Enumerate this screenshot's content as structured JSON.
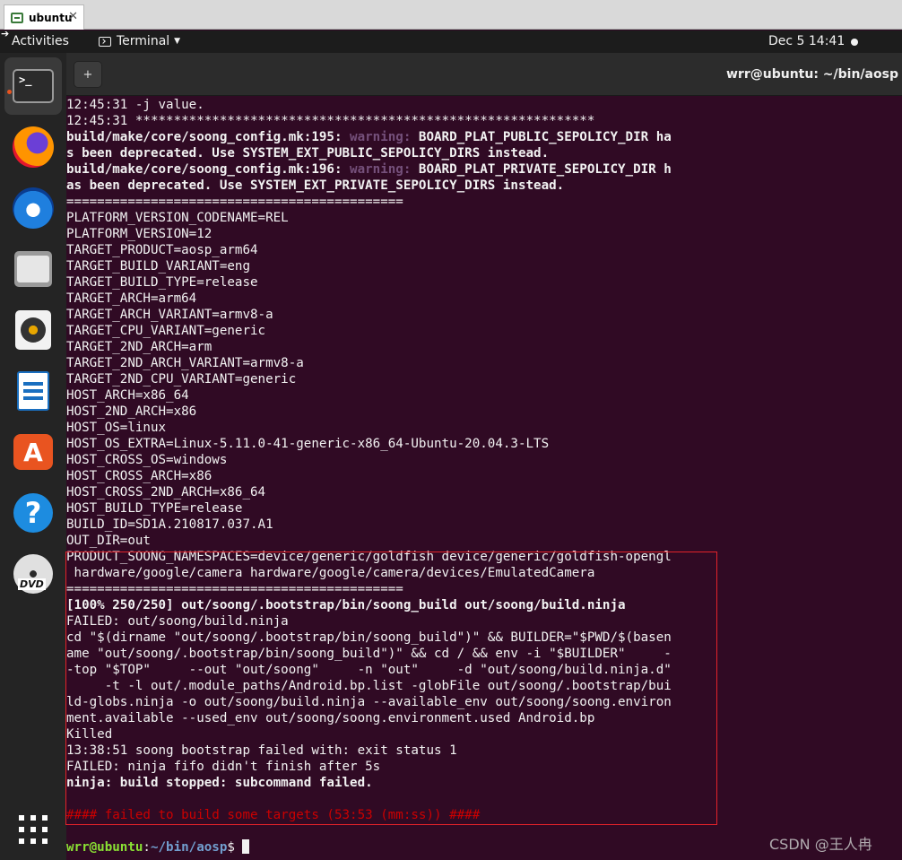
{
  "vm_tab": {
    "label": "ubuntu",
    "close": "✕"
  },
  "topbar": {
    "activities": "Activities",
    "app_menu": "Terminal",
    "clock": "Dec 5  14:41"
  },
  "dock": {
    "items": [
      "Terminal",
      "Firefox",
      "Thunderbird",
      "Files",
      "Rhythmbox",
      "LibreOffice Writer",
      "Ubuntu Software",
      "Help",
      "DVD",
      "Show Applications"
    ],
    "terminal_glyph": ">_",
    "dvd_label": "DVD",
    "help_glyph": "?",
    "store_glyph": "A"
  },
  "terminal": {
    "title": "wrr@ubuntu: ~/bin/aosp",
    "newtab_glyph": "+",
    "lines": [
      {
        "segs": [
          {
            "t": "12:45:31 -j value."
          }
        ]
      },
      {
        "segs": [
          {
            "t": "12:45:31 ************************************************************"
          }
        ]
      },
      {
        "segs": [
          {
            "t": "build/make/core/soong_config.mk:195: ",
            "c": "b"
          },
          {
            "t": "warning:",
            "c": "warn"
          },
          {
            "t": " BOARD_PLAT_PUBLIC_SEPOLICY_DIR ha",
            "c": "b"
          }
        ]
      },
      {
        "segs": [
          {
            "t": "s been deprecated. Use SYSTEM_EXT_PUBLIC_SEPOLICY_DIRS instead.",
            "c": "b"
          }
        ]
      },
      {
        "segs": [
          {
            "t": "build/make/core/soong_config.mk:196: ",
            "c": "b"
          },
          {
            "t": "warning:",
            "c": "warn"
          },
          {
            "t": " BOARD_PLAT_PRIVATE_SEPOLICY_DIR h",
            "c": "b"
          }
        ]
      },
      {
        "segs": [
          {
            "t": "as been deprecated. Use SYSTEM_EXT_PRIVATE_SEPOLICY_DIRS instead.",
            "c": "b"
          }
        ]
      },
      {
        "segs": [
          {
            "t": "============================================"
          }
        ]
      },
      {
        "segs": [
          {
            "t": "PLATFORM_VERSION_CODENAME=REL"
          }
        ]
      },
      {
        "segs": [
          {
            "t": "PLATFORM_VERSION=12"
          }
        ]
      },
      {
        "segs": [
          {
            "t": "TARGET_PRODUCT=aosp_arm64"
          }
        ]
      },
      {
        "segs": [
          {
            "t": "TARGET_BUILD_VARIANT=eng"
          }
        ]
      },
      {
        "segs": [
          {
            "t": "TARGET_BUILD_TYPE=release"
          }
        ]
      },
      {
        "segs": [
          {
            "t": "TARGET_ARCH=arm64"
          }
        ]
      },
      {
        "segs": [
          {
            "t": "TARGET_ARCH_VARIANT=armv8-a"
          }
        ]
      },
      {
        "segs": [
          {
            "t": "TARGET_CPU_VARIANT=generic"
          }
        ]
      },
      {
        "segs": [
          {
            "t": "TARGET_2ND_ARCH=arm"
          }
        ]
      },
      {
        "segs": [
          {
            "t": "TARGET_2ND_ARCH_VARIANT=armv8-a"
          }
        ]
      },
      {
        "segs": [
          {
            "t": "TARGET_2ND_CPU_VARIANT=generic"
          }
        ]
      },
      {
        "segs": [
          {
            "t": "HOST_ARCH=x86_64"
          }
        ]
      },
      {
        "segs": [
          {
            "t": "HOST_2ND_ARCH=x86"
          }
        ]
      },
      {
        "segs": [
          {
            "t": "HOST_OS=linux"
          }
        ]
      },
      {
        "segs": [
          {
            "t": "HOST_OS_EXTRA=Linux-5.11.0-41-generic-x86_64-Ubuntu-20.04.3-LTS"
          }
        ]
      },
      {
        "segs": [
          {
            "t": "HOST_CROSS_OS=windows"
          }
        ]
      },
      {
        "segs": [
          {
            "t": "HOST_CROSS_ARCH=x86"
          }
        ]
      },
      {
        "segs": [
          {
            "t": "HOST_CROSS_2ND_ARCH=x86_64"
          }
        ]
      },
      {
        "segs": [
          {
            "t": "HOST_BUILD_TYPE=release"
          }
        ]
      },
      {
        "segs": [
          {
            "t": "BUILD_ID=SD1A.210817.037.A1"
          }
        ]
      },
      {
        "segs": [
          {
            "t": "OUT_DIR=out"
          }
        ]
      },
      {
        "segs": [
          {
            "t": "PRODUCT_SOONG_NAMESPACES=device/generic/goldfish device/generic/goldfish-opengl"
          }
        ]
      },
      {
        "segs": [
          {
            "t": " hardware/google/camera hardware/google/camera/devices/EmulatedCamera"
          }
        ]
      },
      {
        "segs": [
          {
            "t": "============================================"
          }
        ]
      },
      {
        "segs": [
          {
            "t": "[100% 250/250] out/soong/.bootstrap/bin/soong_build out/soong/build.ninja",
            "c": "b"
          }
        ]
      },
      {
        "segs": [
          {
            "t": "FAILED: out/soong/build.ninja"
          }
        ]
      },
      {
        "segs": [
          {
            "t": "cd \"$(dirname \"out/soong/.bootstrap/bin/soong_build\")\" && BUILDER=\"$PWD/$(basen"
          }
        ]
      },
      {
        "segs": [
          {
            "t": "ame \"out/soong/.bootstrap/bin/soong_build\")\" && cd / && env -i \"$BUILDER\"     -"
          }
        ]
      },
      {
        "segs": [
          {
            "t": "-top \"$TOP\"     --out \"out/soong\"     -n \"out\"     -d \"out/soong/build.ninja.d\""
          }
        ]
      },
      {
        "segs": [
          {
            "t": "     -t -l out/.module_paths/Android.bp.list -globFile out/soong/.bootstrap/bui"
          }
        ]
      },
      {
        "segs": [
          {
            "t": "ld-globs.ninja -o out/soong/build.ninja --available_env out/soong/soong.environ"
          }
        ]
      },
      {
        "segs": [
          {
            "t": "ment.available --used_env out/soong/soong.environment.used Android.bp"
          }
        ]
      },
      {
        "segs": [
          {
            "t": "Killed"
          }
        ]
      },
      {
        "segs": [
          {
            "t": "13:38:51 soong bootstrap failed with: exit status 1"
          }
        ]
      },
      {
        "segs": [
          {
            "t": "FAILED: ninja fifo didn't finish after 5s"
          }
        ]
      },
      {
        "segs": [
          {
            "t": "ninja: build stopped: subcommand failed.",
            "c": "b"
          }
        ]
      },
      {
        "segs": [
          {
            "t": ""
          }
        ]
      },
      {
        "segs": [
          {
            "t": "#### failed to build some targets (53:53 (mm:ss)) ####",
            "c": "err"
          }
        ]
      },
      {
        "segs": [
          {
            "t": ""
          }
        ]
      }
    ],
    "prompt": {
      "user_host": "wrr@ubuntu",
      "sep": ":",
      "path": "~/bin/aosp",
      "symbol": "$ "
    }
  },
  "watermark": "CSDN @王人冉"
}
